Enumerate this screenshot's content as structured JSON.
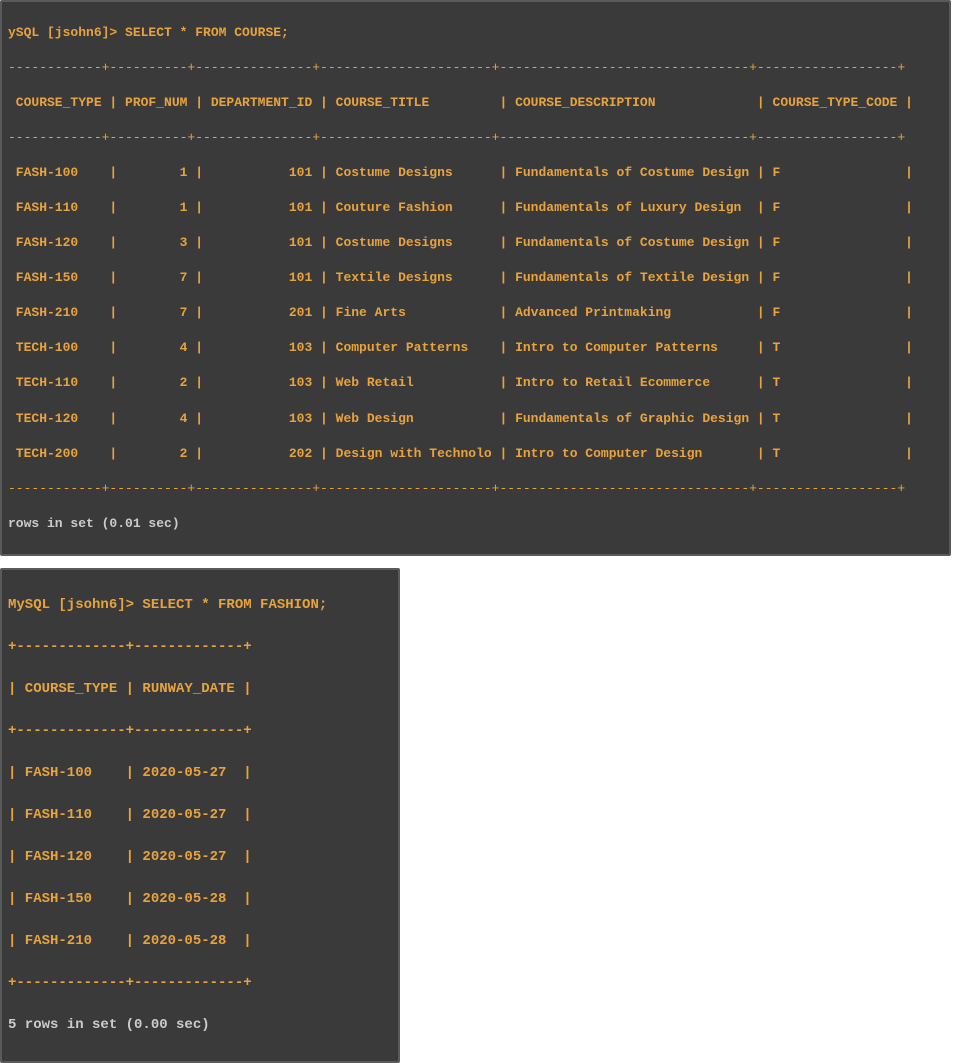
{
  "terminal1": {
    "prompt": "ySQL [jsohn6]> SELECT * FROM COURSE;",
    "border_top": "------------+----------+---------------+----------------------+--------------------------------+------------------+",
    "header_line": " COURSE_TYPE | PROF_NUM | DEPARTMENT_ID | COURSE_TITLE         | COURSE_DESCRIPTION             | COURSE_TYPE_CODE |",
    "border_mid": "------------+----------+---------------+----------------------+--------------------------------+------------------+",
    "rows": [
      " FASH-100    |        1 |           101 | Costume Designs      | Fundamentals of Costume Design | F                |",
      " FASH-110    |        1 |           101 | Couture Fashion      | Fundamentals of Luxury Design  | F                |",
      " FASH-120    |        3 |           101 | Costume Designs      | Fundamentals of Costume Design | F                |",
      " FASH-150    |        7 |           101 | Textile Designs      | Fundamentals of Textile Design | F                |",
      " FASH-210    |        7 |           201 | Fine Arts            | Advanced Printmaking           | F                |",
      " TECH-100    |        4 |           103 | Computer Patterns    | Intro to Computer Patterns     | T                |",
      " TECH-110    |        2 |           103 | Web Retail           | Intro to Retail Ecommerce      | T                |",
      " TECH-120    |        4 |           103 | Web Design           | Fundamentals of Graphic Design | T                |",
      " TECH-200    |        2 |           202 | Design with Technolo | Intro to Computer Design       | T                |"
    ],
    "border_bot": "------------+----------+---------------+----------------------+--------------------------------+------------------+",
    "result": "rows in set (0.01 sec)"
  },
  "terminal2": {
    "prompt": "MySQL [jsohn6]> SELECT * FROM FASHION;",
    "border_top": "+-------------+-------------+",
    "header_line": "| COURSE_TYPE | RUNWAY_DATE |",
    "border_mid": "+-------------+-------------+",
    "rows": [
      "| FASH-100    | 2020-05-27  |",
      "| FASH-110    | 2020-05-27  |",
      "| FASH-120    | 2020-05-27  |",
      "| FASH-150    | 2020-05-28  |",
      "| FASH-210    | 2020-05-28  |"
    ],
    "border_bot": "+-------------+-------------+",
    "result": "5 rows in set (0.00 sec)"
  }
}
